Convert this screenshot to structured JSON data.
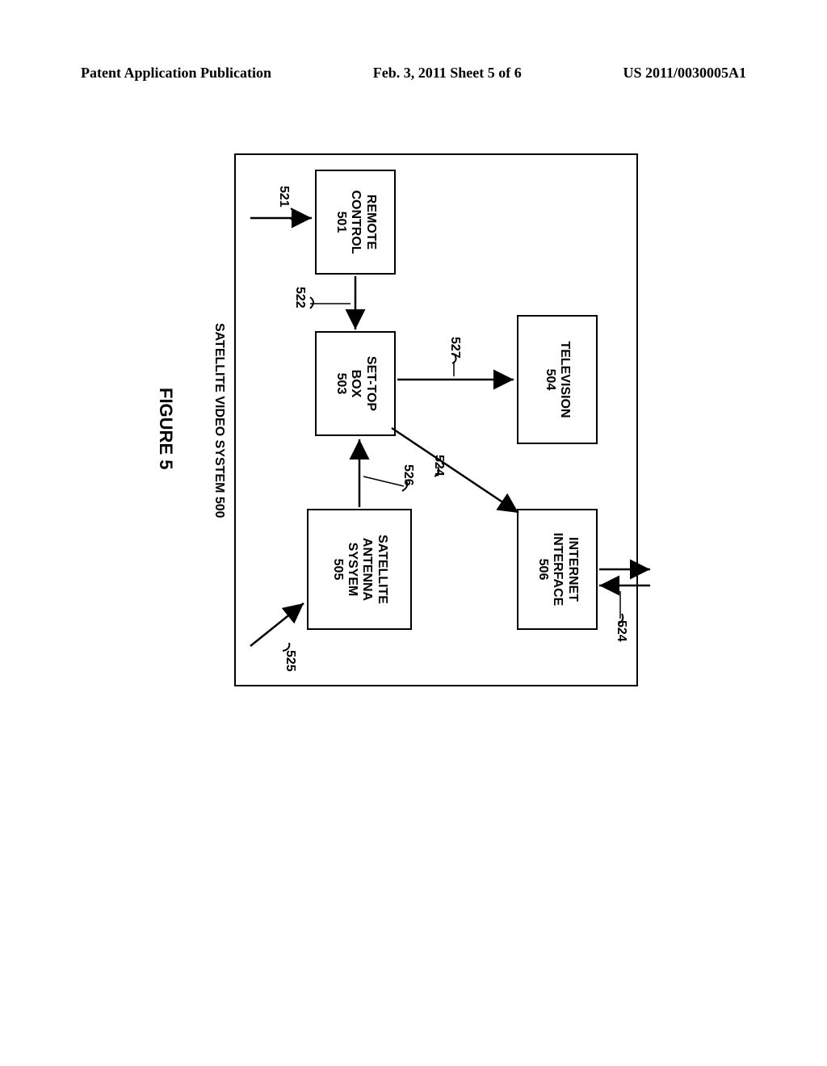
{
  "header": {
    "left": "Patent Application Publication",
    "center": "Feb. 3, 2011  Sheet 5 of 6",
    "right": "US 2011/0030005A1"
  },
  "blocks": {
    "remote": {
      "line1": "REMOTE",
      "line2": "CONTROL",
      "ref": "501"
    },
    "stb": {
      "line1": "SET-TOP",
      "line2": "BOX",
      "ref": "503"
    },
    "sat": {
      "line1": "SATELLITE",
      "line2": "ANTENNA",
      "line3": "SYSYEM",
      "ref": "505"
    },
    "tv": {
      "line1": "TELEVISION",
      "ref": "504"
    },
    "inet": {
      "line1": "INTERNET",
      "line2": "INTERFACE",
      "ref": "506"
    }
  },
  "refs": {
    "r521": "521",
    "r522": "522",
    "r524a": "524",
    "r524b": "524",
    "r525": "525",
    "r526": "526",
    "r527": "527"
  },
  "system_label": "SATELLITE VIDEO SYSTEM 500",
  "figure_label": "FIGURE 5"
}
